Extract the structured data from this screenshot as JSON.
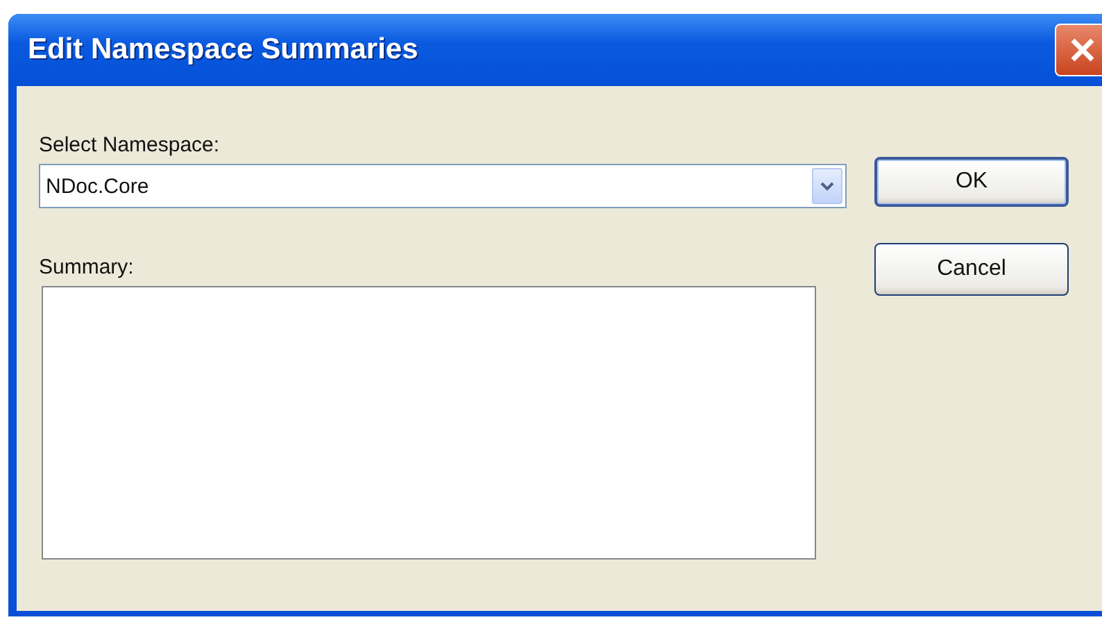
{
  "window": {
    "title": "Edit Namespace Summaries"
  },
  "namespace": {
    "label": "Select Namespace:",
    "value": "NDoc.Core"
  },
  "summary": {
    "label": "Summary:"
  },
  "buttons": [
    {
      "label": "OK",
      "default": true
    },
    {
      "label": "Cancel",
      "default": false
    }
  ]
}
